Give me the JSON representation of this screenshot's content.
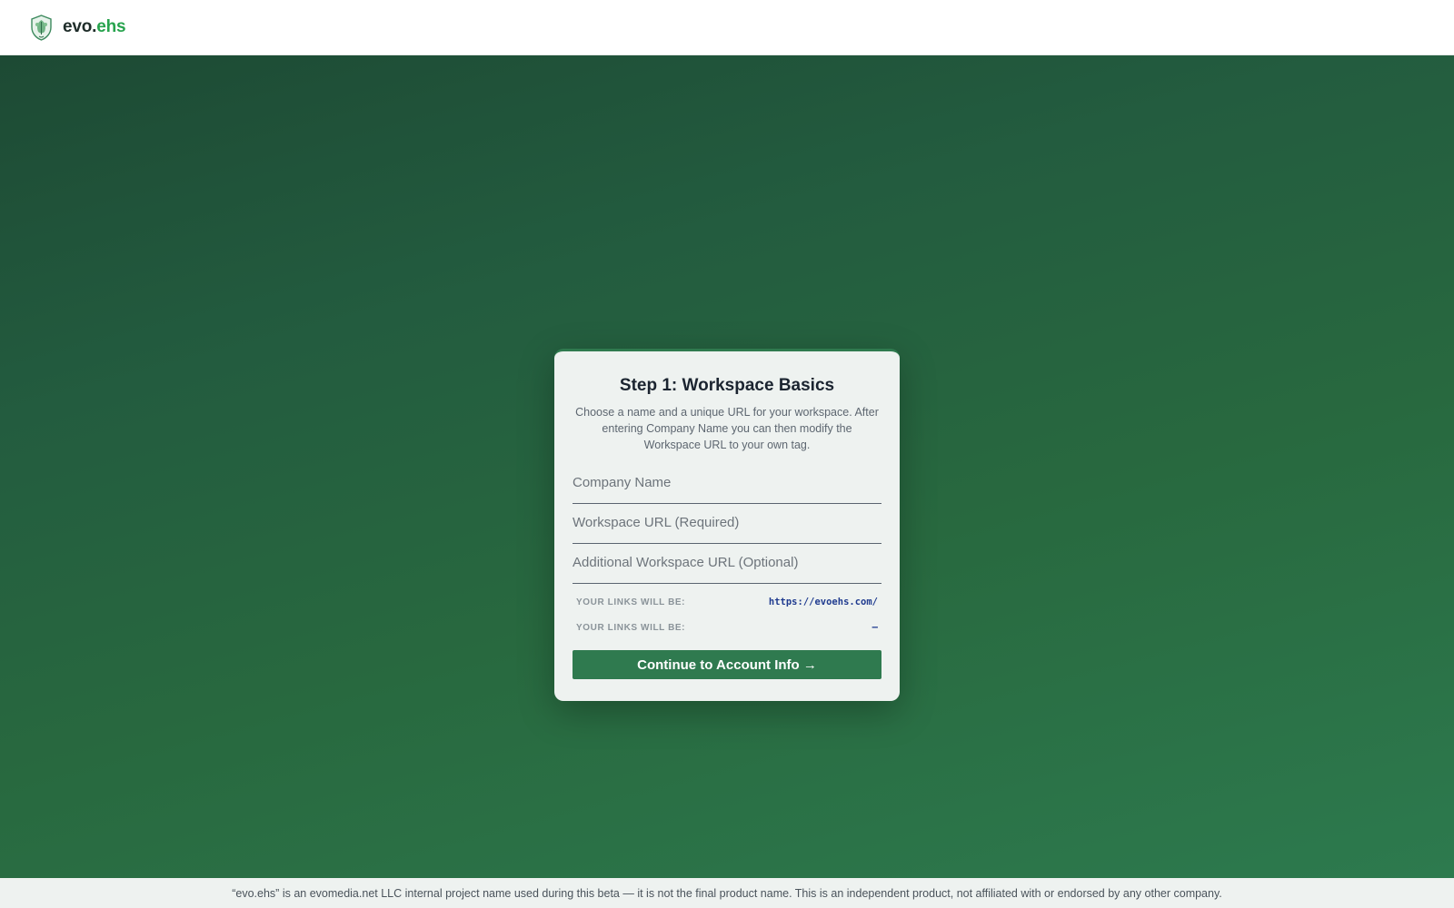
{
  "header": {
    "logo_icon": "shield-leaf-icon",
    "brand_part1": "evo",
    "brand_dot": ".",
    "brand_part2": "ehs",
    "brand_accent_color": "#27a34d"
  },
  "colors": {
    "hero_gradient_start": "#1d4a34",
    "hero_gradient_end": "#2d7a4e",
    "button": "#2f7a4f",
    "link_value": "#1f3b8f"
  },
  "card": {
    "title": "Step 1: Workspace Basics",
    "description": "Choose a name and a unique URL for your workspace. After entering Company Name you can then modify the Workspace URL to your own tag.",
    "fields": {
      "company_name": {
        "placeholder": "Company Name",
        "value": ""
      },
      "workspace_url": {
        "placeholder": "Workspace URL (Required)",
        "value": ""
      },
      "additional_url": {
        "placeholder": "Additional Workspace URL (Optional)",
        "value": ""
      }
    },
    "links": [
      {
        "label": "YOUR LINKS WILL BE:",
        "value": "https://evoehs.com/"
      },
      {
        "label": "YOUR LINKS WILL BE:",
        "value": "—"
      }
    ],
    "continue_label": "Continue to Account Info →"
  },
  "footer": {
    "disclaimer": "“evo.ehs” is an evomedia.net LLC internal project name used during this beta — it is not the final product name. This is an independent product, not affiliated with or endorsed by any other company."
  }
}
